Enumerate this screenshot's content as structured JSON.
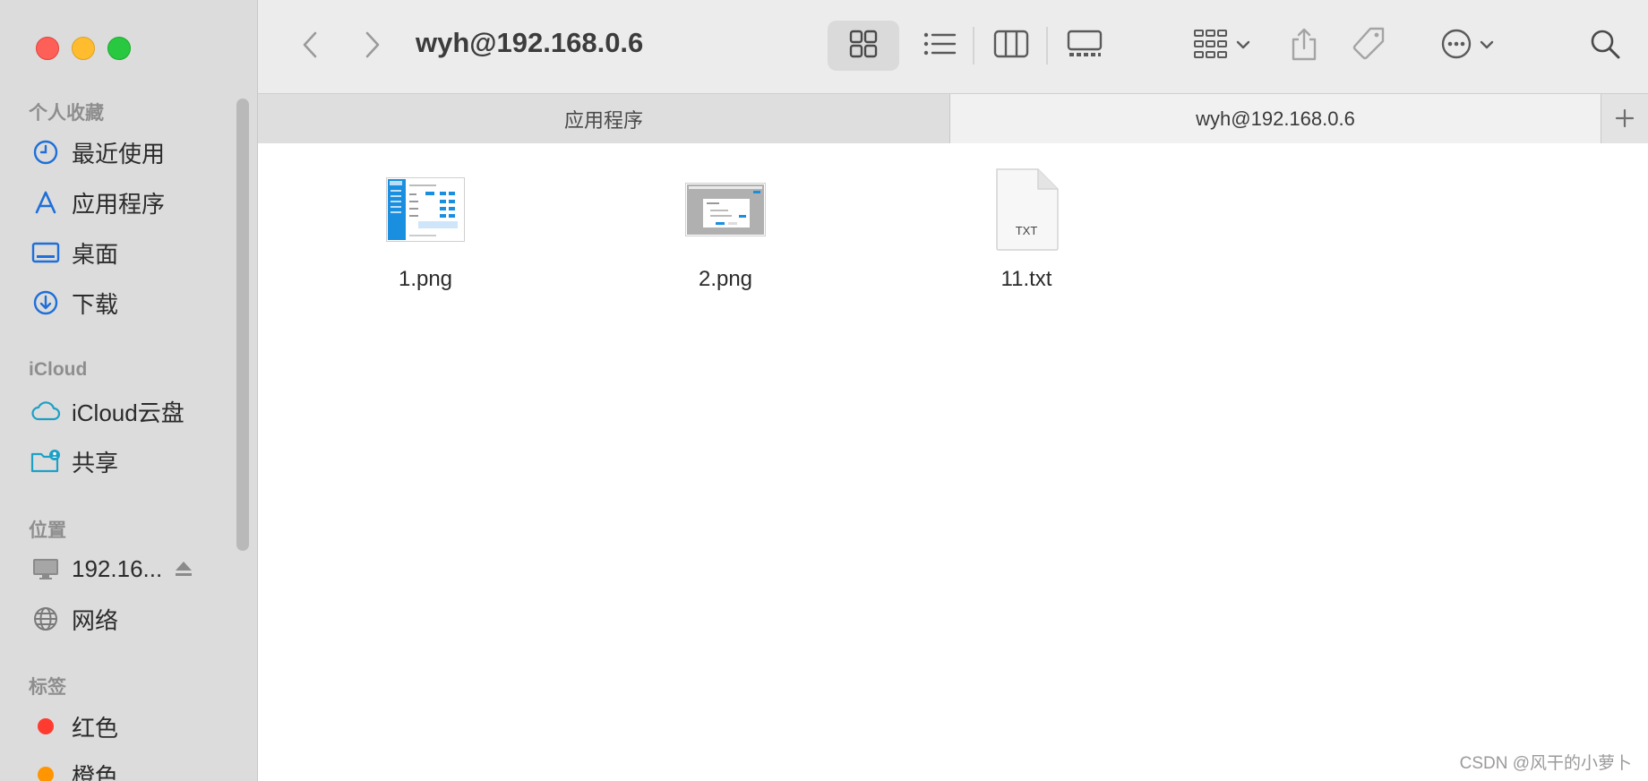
{
  "window": {
    "title": "wyh@192.168.0.6"
  },
  "sidebar": {
    "sections": [
      {
        "heading": "个人收藏",
        "items": [
          {
            "label": "最近使用",
            "icon": "clock-icon"
          },
          {
            "label": "应用程序",
            "icon": "applications-icon"
          },
          {
            "label": "桌面",
            "icon": "desktop-icon"
          },
          {
            "label": "下载",
            "icon": "download-icon"
          }
        ]
      },
      {
        "heading": "iCloud",
        "items": [
          {
            "label": "iCloud云盘",
            "icon": "cloud-icon"
          },
          {
            "label": "共享",
            "icon": "shared-folder-icon"
          }
        ]
      },
      {
        "heading": "位置",
        "items": [
          {
            "label": "192.16...",
            "icon": "monitor-icon"
          },
          {
            "label": "网络",
            "icon": "globe-icon"
          }
        ]
      },
      {
        "heading": "标签",
        "items": [
          {
            "label": "红色",
            "icon": "red-tag-icon",
            "color": "#ff3b30"
          },
          {
            "label": "橙色",
            "icon": "orange-tag-icon",
            "color": "#ff9500"
          }
        ]
      }
    ]
  },
  "tabs": [
    {
      "label": "应用程序",
      "active": false
    },
    {
      "label": "wyh@192.168.0.6",
      "active": true
    }
  ],
  "files": [
    {
      "name": "1.png",
      "kind": "image"
    },
    {
      "name": "2.png",
      "kind": "image"
    },
    {
      "name": "11.txt",
      "kind": "text",
      "badge": "TXT"
    }
  ],
  "watermark": "CSDN @风干的小萝卜",
  "colors": {
    "accent": "#1e6fd9",
    "close": "#fe5f57",
    "minimize": "#febc2e",
    "maximize": "#28c840"
  }
}
